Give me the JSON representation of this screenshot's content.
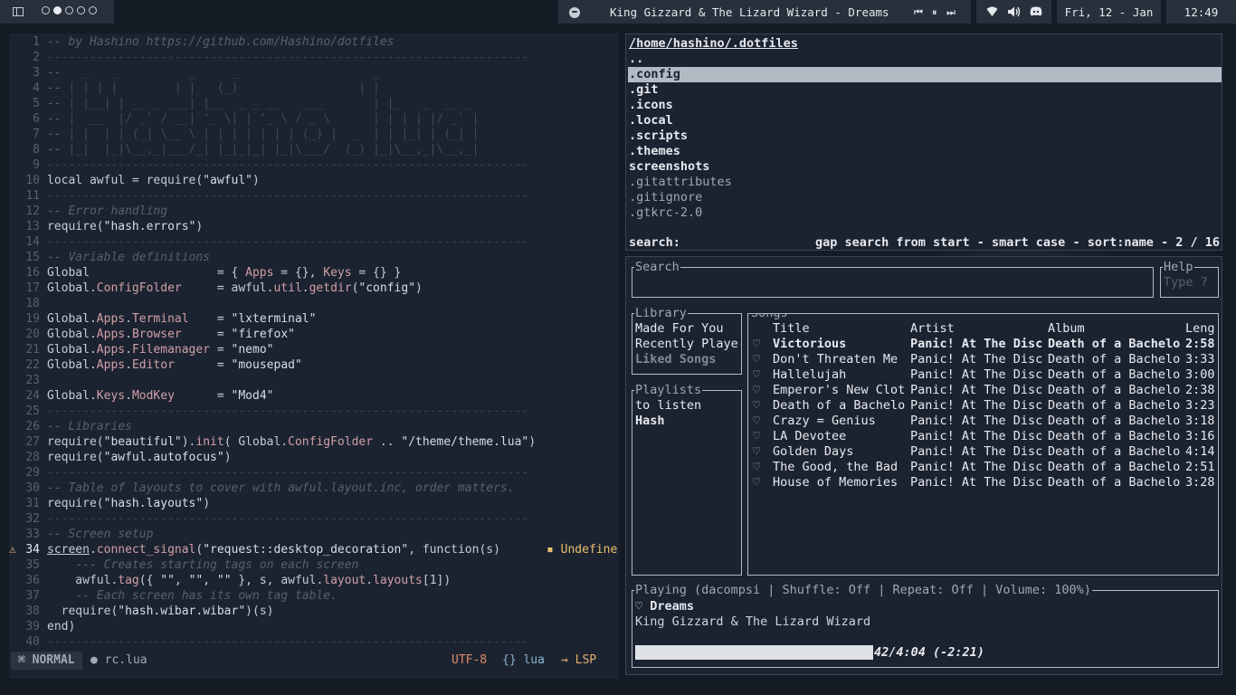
{
  "topbar": {
    "tags": [
      {
        "name": "tag-1",
        "active": false
      },
      {
        "name": "tag-2",
        "active": true
      },
      {
        "name": "tag-3",
        "active": false
      },
      {
        "name": "tag-4",
        "active": false
      },
      {
        "name": "tag-5",
        "active": false
      }
    ],
    "now_playing": "King Gizzard & The Lizard Wizard - Dreams",
    "date": "Fri, 12 - Jan",
    "time": "12:49",
    "icons": [
      "layout-icon",
      "spotify-icon",
      "prev-icon",
      "pause-icon",
      "next-icon",
      "wifi-icon",
      "volume-icon",
      "discord-icon"
    ]
  },
  "editor": {
    "lines": [
      {
        "n": "1",
        "html": "<span class=\"c-com\">-- by Hashino https://github.com/Hashino/dotfiles</span>"
      },
      {
        "n": "2",
        "html": "<span class=\"c-dash\">--------------------------------------------------------------------</span>"
      },
      {
        "n": "3",
        "html": "<span class=\"c-com\">--</span><span class=\"ascii\">   _   _          _     _                   _</span>"
      },
      {
        "n": "4",
        "html": "<span class=\"c-com\">--</span><span class=\"ascii\"> | | | |        | |   (_)                 | |</span>"
      },
      {
        "n": "5",
        "html": "<span class=\"c-com\">--</span><span class=\"ascii\"> | |__| | __ _ ___| |__  _ _ __   ___       | |_   _  __ _</span>"
      },
      {
        "n": "6",
        "html": "<span class=\"c-com\">--</span><span class=\"ascii\"> |  __  |/ _` / __| '_ \\| | '_ \\ / _ \\      | | | | |/ _` |</span>"
      },
      {
        "n": "7",
        "html": "<span class=\"c-com\">--</span><span class=\"ascii\"> | |  | | (_| \\__ \\ | | | | | | | (_) |  _  | | |_| | (_| |</span>"
      },
      {
        "n": "8",
        "html": "<span class=\"c-com\">--</span><span class=\"ascii\"> |_|  |_|\\__,_|___/_| |_|_|_| |_|\\___/  (_) |_|\\__,_|\\__,_|</span>"
      },
      {
        "n": "9",
        "html": "<span class=\"c-dash\">--------------------------------------------------------------------</span>"
      },
      {
        "n": "10",
        "html": "local awful = require(<span class=\"c-str\">\"awful\"</span>)"
      },
      {
        "n": "11",
        "html": "<span class=\"c-dash\">--------------------------------------------------------------------</span>"
      },
      {
        "n": "12",
        "html": "<span class=\"c-com\">-- Error handling</span>"
      },
      {
        "n": "13",
        "html": "require(<span class=\"c-str\">\"hash.errors\"</span>)"
      },
      {
        "n": "14",
        "html": "<span class=\"c-dash\">--------------------------------------------------------------------</span>"
      },
      {
        "n": "15",
        "html": "<span class=\"c-com\">-- Variable definitions</span>"
      },
      {
        "n": "16",
        "html": "Global                  = { <span class=\"c-fld\">Apps</span> = {}, <span class=\"c-fld\">Keys</span> = {} }"
      },
      {
        "n": "17",
        "html": "Global.<span class=\"c-fld\">ConfigFolder</span>     = awful.<span class=\"c-fld\">util</span>.<span class=\"c-fld\">getdir</span>(<span class=\"c-str\">\"config\"</span>)"
      },
      {
        "n": "18",
        "html": ""
      },
      {
        "n": "19",
        "html": "Global.<span class=\"c-fld\">Apps</span>.<span class=\"c-fld\">Terminal</span>    = <span class=\"c-str\">\"lxterminal\"</span>"
      },
      {
        "n": "20",
        "html": "Global.<span class=\"c-fld\">Apps</span>.<span class=\"c-fld\">Browser</span>     = <span class=\"c-str\">\"firefox\"</span>"
      },
      {
        "n": "21",
        "html": "Global.<span class=\"c-fld\">Apps</span>.<span class=\"c-fld\">Filemanager</span> = <span class=\"c-str\">\"nemo\"</span>"
      },
      {
        "n": "22",
        "html": "Global.<span class=\"c-fld\">Apps</span>.<span class=\"c-fld\">Editor</span>      = <span class=\"c-str\">\"mousepad\"</span>"
      },
      {
        "n": "23",
        "html": ""
      },
      {
        "n": "24",
        "html": "Global.<span class=\"c-fld\">Keys</span>.<span class=\"c-fld\">ModKey</span>      = <span class=\"c-str\">\"Mod4\"</span>"
      },
      {
        "n": "25",
        "html": "<span class=\"c-dash\">--------------------------------------------------------------------</span>"
      },
      {
        "n": "26",
        "html": "<span class=\"c-com\">-- Libraries</span>"
      },
      {
        "n": "27",
        "html": "require(<span class=\"c-str\">\"beautiful\"</span>).<span class=\"c-fld\">init</span>( Global.<span class=\"c-fld\">ConfigFolder</span> .. <span class=\"c-str\">\"/theme/theme.lua\"</span>)"
      },
      {
        "n": "28",
        "html": "require(<span class=\"c-str\">\"awful.autofocus\"</span>)"
      },
      {
        "n": "29",
        "html": "<span class=\"c-dash\">--------------------------------------------------------------------</span>"
      },
      {
        "n": "30",
        "html": "<span class=\"c-com\">-- Table of layouts to cover with awful.layout.inc, order matters.</span>"
      },
      {
        "n": "31",
        "html": "require(<span class=\"c-str\">\"hash.layouts\"</span>)"
      },
      {
        "n": "32",
        "html": "<span class=\"c-dash\">--------------------------------------------------------------------</span>"
      },
      {
        "n": "33",
        "html": "<span class=\"c-com\">-- Screen setup</span>"
      },
      {
        "n": "34",
        "html": "<span style=\"text-decoration:underline\">screen</span>.<span class=\"c-fld\">connect_signal</span>(<span class=\"c-str\">\"request::desktop_decoration\"</span>, function(s)",
        "cur": true,
        "warn": true
      },
      {
        "n": "35",
        "html": "    <span class=\"c-com\">--- Creates starting tags on each screen</span>"
      },
      {
        "n": "36",
        "html": "    awful.<span class=\"c-fld\">tag</span>({ <span class=\"c-str\">\"\"</span>, <span class=\"c-str\">\"\"</span>, <span class=\"c-str\">\"\"</span> }, s, awful.<span class=\"c-fld\">layout</span>.<span class=\"c-fld\">layouts</span>[1])"
      },
      {
        "n": "37",
        "html": "    <span class=\"c-com\">-- Each screen has its own tag table.</span>"
      },
      {
        "n": "38",
        "html": "  require(<span class=\"c-str\">\"hash.wibar.wibar\"</span>)(s)"
      },
      {
        "n": "39",
        "html": "end)"
      },
      {
        "n": "40",
        "html": "<span class=\"c-dash\">--------------------------------------------------------------------</span>"
      }
    ],
    "virtual_text": "▪ Undefine",
    "status": {
      "mode": "⌘ NORMAL",
      "filename": "● rc.lua",
      "encoding": "UTF-8",
      "filetype": "{} lua",
      "lsp": "⇝ LSP"
    }
  },
  "filemanager": {
    "path": "/home/hashino/.dotfiles",
    "entries": [
      {
        "name": "..",
        "kind": "dir",
        "selected": false
      },
      {
        "name": ".config",
        "kind": "dir",
        "selected": true
      },
      {
        "name": ".git",
        "kind": "dir",
        "selected": false
      },
      {
        "name": ".icons",
        "kind": "dir",
        "selected": false
      },
      {
        "name": ".local",
        "kind": "dir",
        "selected": false
      },
      {
        "name": ".scripts",
        "kind": "dir",
        "selected": false
      },
      {
        "name": ".themes",
        "kind": "dir",
        "selected": false
      },
      {
        "name": "screenshots",
        "kind": "dir",
        "selected": false
      },
      {
        "name": ".gitattributes",
        "kind": "file",
        "selected": false
      },
      {
        "name": ".gitignore",
        "kind": "file",
        "selected": false
      },
      {
        "name": ".gtkrc-2.0",
        "kind": "file",
        "selected": false
      }
    ],
    "search_label": "search:",
    "info": "gap search from start - smart case - sort:name - 2 / 16"
  },
  "spotify": {
    "search_title": "Search",
    "help_title": "Help",
    "help_hint": "Type ?",
    "library_title": "Library",
    "library_items": [
      {
        "label": "Made For You",
        "active": false
      },
      {
        "label": "Recently Playe",
        "active": false
      },
      {
        "label": "Liked Songs",
        "active": true
      }
    ],
    "playlists_title": "Playlists",
    "playlists": [
      {
        "label": "to listen",
        "bold": false
      },
      {
        "label": "Hash",
        "bold": true
      }
    ],
    "songs_title": "Songs",
    "columns": {
      "title": "Title",
      "artist": "Artist",
      "album": "Album",
      "length": "Leng"
    },
    "songs": [
      {
        "heart": "♡",
        "title": "Victorious",
        "artist": "Panic! At The Disc",
        "album": "Death of a Bachelo",
        "length": "2:58",
        "highlight": true
      },
      {
        "heart": "♡",
        "title": "Don't Threaten Me",
        "artist": "Panic! At The Disc",
        "album": "Death of a Bachelo",
        "length": "3:33"
      },
      {
        "heart": "♡",
        "title": "Hallelujah",
        "artist": "Panic! At The Disc",
        "album": "Death of a Bachelo",
        "length": "3:00"
      },
      {
        "heart": "♡",
        "title": "Emperor's New Clot",
        "artist": "Panic! At The Disc",
        "album": "Death of a Bachelo",
        "length": "2:38"
      },
      {
        "heart": "♡",
        "title": "Death of a Bachelo",
        "artist": "Panic! At The Disc",
        "album": "Death of a Bachelo",
        "length": "3:23"
      },
      {
        "heart": "♡",
        "title": "Crazy = Genius",
        "artist": "Panic! At The Disc",
        "album": "Death of a Bachelo",
        "length": "3:18"
      },
      {
        "heart": "♡",
        "title": "LA Devotee",
        "artist": "Panic! At The Disc",
        "album": "Death of a Bachelo",
        "length": "3:16"
      },
      {
        "heart": "♡",
        "title": "Golden Days",
        "artist": "Panic! At The Disc",
        "album": "Death of a Bachelo",
        "length": "4:14"
      },
      {
        "heart": "♡",
        "title": "The Good, the Bad",
        "artist": "Panic! At The Disc",
        "album": "Death of a Bachelo",
        "length": "2:51"
      },
      {
        "heart": "♡",
        "title": "House of Memories",
        "artist": "Panic! At The Disc",
        "album": "Death of a Bachelo",
        "length": "3:28"
      }
    ],
    "playback_title": "Playing (dacompsi | Shuffle: Off | Repeat: Off   | Volume: 100%)",
    "track_title": "♡ Dreams",
    "track_artist": "King Gizzard & The Lizard Wizard",
    "progress_fraction": 0.41,
    "progress_text": "42/4:04 (-2:21)"
  }
}
